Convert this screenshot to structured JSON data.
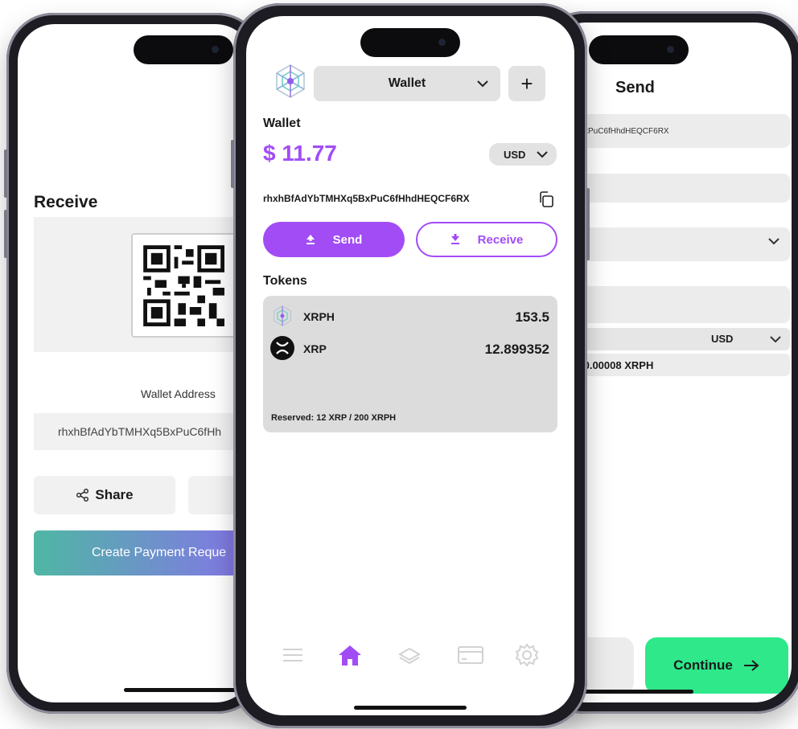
{
  "receive_screen": {
    "title": "Receive",
    "wallet_address_label": "Wallet Address",
    "wallet_address_value": "rhxhBfAdYbTMHXq5BxPuC6fHh",
    "share_label": "Share",
    "create_request_label": "Create Payment Reque",
    "accent_gradient": [
      "#4fb7a4",
      "#8b6cf0"
    ]
  },
  "wallet_screen": {
    "wallet_select": "Wallet",
    "add_label": "+",
    "wallet_heading": "Wallet",
    "balance": "$ 11.77",
    "currency": "USD",
    "address": "rhxhBfAdYbTMHXq5BxPuC6fHhdHEQCF6RX",
    "send_label": "Send",
    "receive_label": "Receive",
    "tokens_heading": "Tokens",
    "tokens": [
      {
        "symbol": "XRPH",
        "amount": "153.5",
        "icon": "xrph-logo-icon"
      },
      {
        "symbol": "XRP",
        "amount": "12.899352",
        "icon": "xrp-logo-icon"
      }
    ],
    "reserved": "Reserved: 12 XRP / 200 XRPH",
    "nav": [
      "menu-icon",
      "home-icon",
      "layers-icon",
      "card-icon",
      "settings-icon"
    ],
    "accent": "#a24cf5"
  },
  "send_screen": {
    "title": "Send",
    "address_fragment": "xPuC6fHhdHEQCF6RX",
    "currency": "USD",
    "fee_text": ".0.00008 XRPH",
    "continue_label": "Continue",
    "continue_color": "#2ee88a"
  }
}
